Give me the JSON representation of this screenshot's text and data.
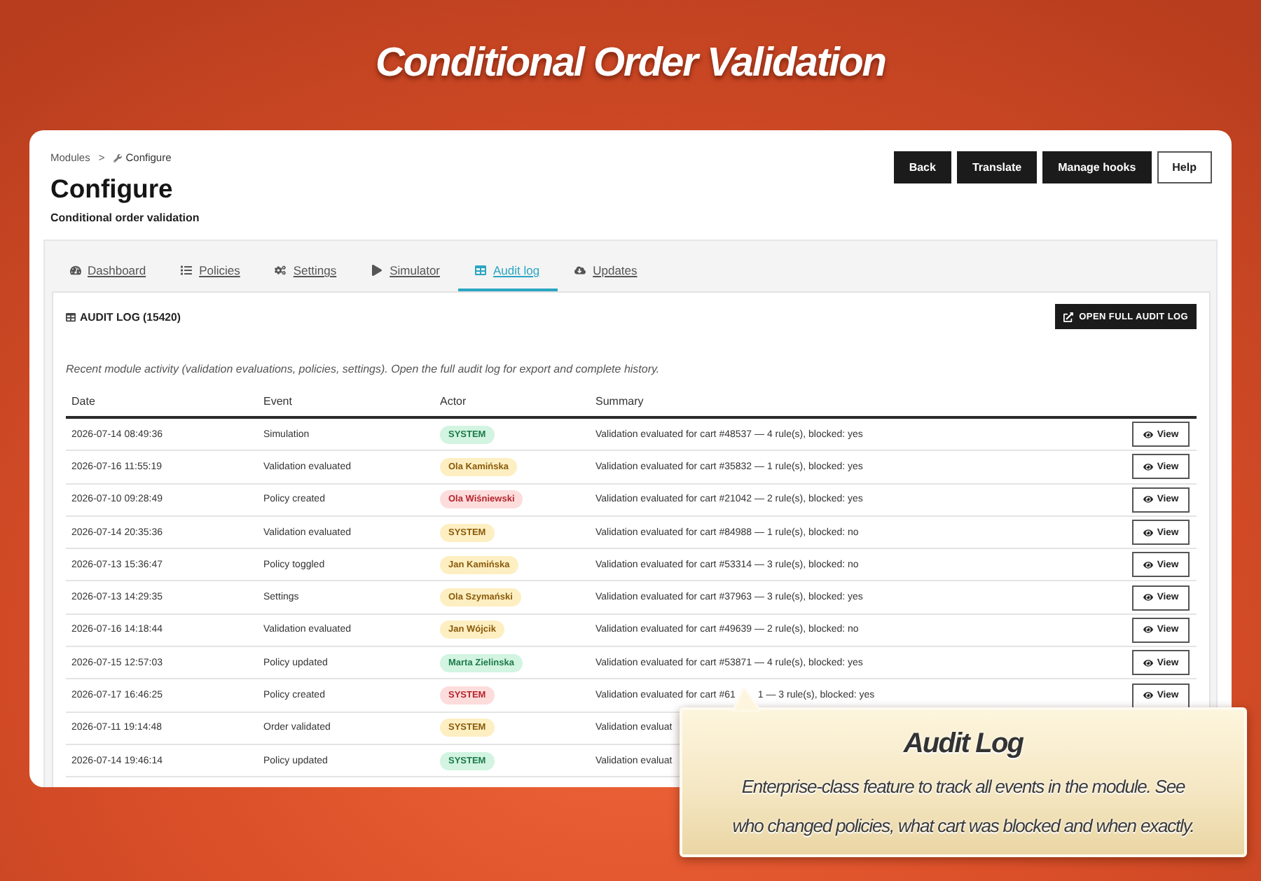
{
  "page_title": "Conditional Order Validation",
  "breadcrumb": {
    "items": [
      "Modules",
      "Configure"
    ],
    "separator": ">"
  },
  "header": {
    "title": "Configure",
    "subtitle": "Conditional order validation",
    "buttons": [
      {
        "label": "Back",
        "kind": "dark"
      },
      {
        "label": "Translate",
        "kind": "dark"
      },
      {
        "label": "Manage hooks",
        "kind": "dark"
      },
      {
        "label": "Help",
        "kind": "outline"
      }
    ]
  },
  "tabs": [
    {
      "label": "Dashboard",
      "selected": false
    },
    {
      "label": "Policies",
      "selected": false
    },
    {
      "label": "Settings",
      "selected": false
    },
    {
      "label": "Simulator",
      "selected": false
    },
    {
      "label": "Audit log",
      "selected": true
    },
    {
      "label": "Updates",
      "selected": false
    }
  ],
  "audit_log": {
    "title": "AUDIT LOG (15420)",
    "action": "OPEN FULL AUDIT LOG",
    "description": "Recent module activity (validation evaluations, policies, settings). Open the full audit log for export and complete history.",
    "columns": [
      "Date",
      "Event",
      "Actor",
      "Summary"
    ],
    "rows": [
      {
        "date": "2026-07-14 08:49:36",
        "event": "Simulation",
        "actor": {
          "name": "SYSTEM",
          "color": "#d2f4e1"
        },
        "summary": [
          "Validation evaluated for cart #48537 — 4 rule(s), blocked: yes"
        ],
        "view": "View"
      },
      {
        "date": "2026-07-16 11:55:19",
        "event": "Validation evaluated",
        "actor": {
          "name": "Ola Kamińska",
          "color": "#fdefc2"
        },
        "summary": [
          "Validation evaluated for cart #35832 — 1 rule(s), blocked: yes"
        ],
        "view": "View"
      },
      {
        "date": "2026-07-10 09:28:49",
        "event": "Policy created",
        "actor": {
          "name": "Ola Wiśniewski",
          "color": "#fddcdc"
        },
        "summary": [
          "Validation evaluated for cart #21042 — 2 rule(s), blocked: yes"
        ],
        "view": "View"
      },
      {
        "date": "2026-07-14 20:35:36",
        "event": "Validation evaluated",
        "actor": {
          "name": "SYSTEM",
          "color": "#fdefc2"
        },
        "summary": [
          "Validation evaluated for cart #84988 — 1 rule(s), blocked: no"
        ],
        "view": "View"
      },
      {
        "date": "2026-07-13 15:36:47",
        "event": "Policy toggled",
        "actor": {
          "name": "Jan Kamińska",
          "color": "#fdefc2"
        },
        "summary": [
          "Validation evaluated for cart #53314 — 3 rule(s), blocked: no"
        ],
        "view": "View"
      },
      {
        "date": "2026-07-13 14:29:35",
        "event": "Settings",
        "actor": {
          "name": "Ola Szymański",
          "color": "#fdefc2"
        },
        "summary": [
          "Validation evaluated for cart #37963 — 3 rule(s), blocked: yes"
        ],
        "view": "View"
      },
      {
        "date": "2026-07-16 14:18:44",
        "event": "Validation evaluated",
        "actor": {
          "name": "Jan Wójcik",
          "color": "#fdefc2"
        },
        "summary": [
          "Validation evaluated for cart #49639 — 2 rule(s), blocked: no"
        ],
        "view": "View"
      },
      {
        "date": "2026-07-15 12:57:03",
        "event": "Policy updated",
        "actor": {
          "name": "Marta Zielinska",
          "color": "#d2f4e1"
        },
        "summary": [
          "Validation evaluated for cart #53871 — 4 rule(s), blocked: yes"
        ],
        "view": "View"
      },
      {
        "date": "2026-07-17 16:46:25",
        "event": "Policy created",
        "actor": {
          "name": "SYSTEM",
          "color": "#fddcdc"
        },
        "summary": [
          "Validation evaluated for cart #61",
          "1 — 3 rule(s), blocked: yes"
        ],
        "view": "View"
      },
      {
        "date": "2026-07-11 19:14:48",
        "event": "Order validated",
        "actor": {
          "name": "SYSTEM",
          "color": "#fdefc2"
        },
        "summary": [
          "Validation evaluat"
        ]
      },
      {
        "date": "2026-07-14 19:46:14",
        "event": "Policy updated",
        "actor": {
          "name": "SYSTEM",
          "color": "#d2f4e1"
        },
        "summary": [
          "Validation evaluat"
        ]
      }
    ]
  },
  "callout": {
    "title": "Audit Log",
    "text": "Enterprise-class feature to track all events in the module. See who changed policies, what cart was blocked and when exactly."
  }
}
